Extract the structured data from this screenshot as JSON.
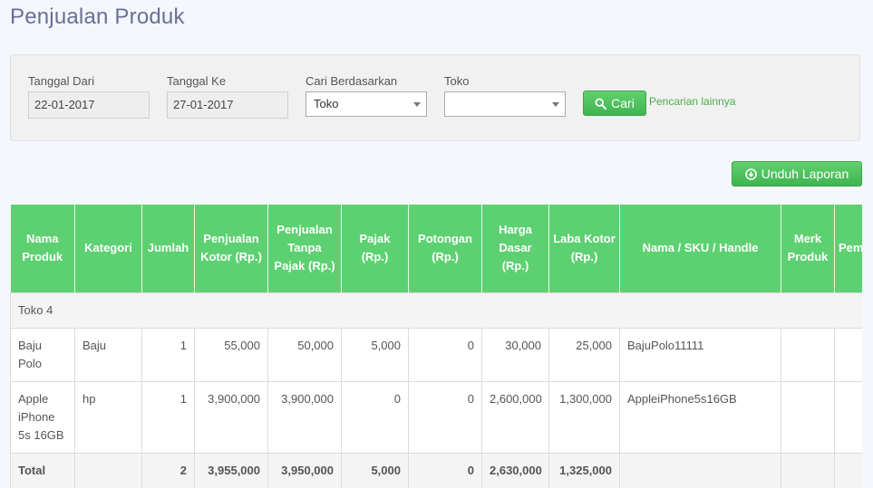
{
  "page": {
    "title": "Penjualan Produk"
  },
  "filters": {
    "date_from": {
      "label": "Tanggal Dari",
      "value": "22-01-2017"
    },
    "date_to": {
      "label": "Tanggal Ke",
      "value": "27-01-2017"
    },
    "search_by": {
      "label": "Cari Berdasarkan",
      "selected": "Toko"
    },
    "store": {
      "label": "Toko",
      "selected": ""
    },
    "search_button": "Cari",
    "more_search_link": "Pencarian lainnya"
  },
  "download_button": "Unduh Laporan",
  "table": {
    "headers": [
      "Nama Produk",
      "Kategori",
      "Jumlah",
      "Penjualan Kotor (Rp.)",
      "Penjualan Tanpa Pajak (Rp.)",
      "Pajak (Rp.)",
      "Potongan (Rp.)",
      "Harga Dasar (Rp.)",
      "Laba Kotor (Rp.)",
      "Nama / SKU / Handle",
      "Merk Produk",
      "Pem"
    ],
    "group_label": "Toko 4",
    "rows": [
      {
        "product": "Baju Polo",
        "category": "Baju",
        "qty": "1",
        "gross": "55,000",
        "net": "50,000",
        "tax": "5,000",
        "discount": "0",
        "cost": "30,000",
        "profit": "25,000",
        "sku": "BajuPolo11111",
        "brand": "",
        "extra": ""
      },
      {
        "product": "Apple iPhone 5s 16GB",
        "category": "hp",
        "qty": "1",
        "gross": "3,900,000",
        "net": "3,900,000",
        "tax": "0",
        "discount": "0",
        "cost": "2,600,000",
        "profit": "1,300,000",
        "sku": "AppleiPhone5s16GB",
        "brand": "",
        "extra": ""
      }
    ],
    "total": {
      "label": "Total",
      "qty": "2",
      "gross": "3,955,000",
      "net": "3,950,000",
      "tax": "5,000",
      "discount": "0",
      "cost": "2,630,000",
      "profit": "1,325,000"
    }
  },
  "colors": {
    "title": "#6a6f94",
    "accent_green": "#5dd171",
    "link_green": "#4cae4c"
  },
  "icons": {
    "search": "search-icon",
    "download": "download-circle-icon"
  }
}
